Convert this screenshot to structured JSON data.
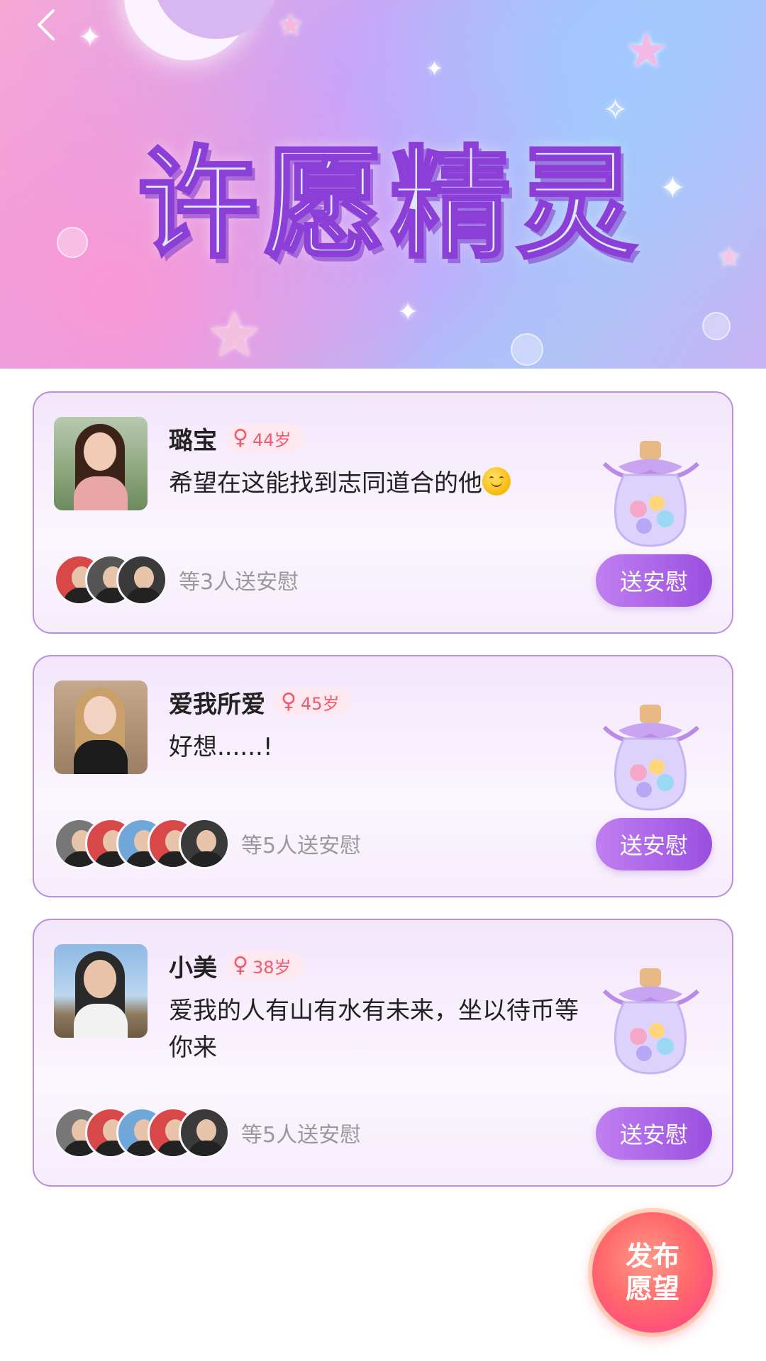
{
  "banner": {
    "title": "许愿精灵"
  },
  "wishes": [
    {
      "username": "璐宝",
      "age": "44岁",
      "gender_symbol": "♀",
      "text": "希望在这能找到志同道合的他",
      "supporters_text": "等3人送安慰",
      "comfort_label": "送安慰"
    },
    {
      "username": "爱我所爱",
      "age": "45岁",
      "gender_symbol": "♀",
      "text": "好想......!",
      "supporters_text": "等5人送安慰",
      "comfort_label": "送安慰"
    },
    {
      "username": "小美",
      "age": "38岁",
      "gender_symbol": "♀",
      "text": "爱我的人有山有水有未来，坐以待币等你来",
      "supporters_text": "等5人送安慰",
      "comfort_label": "送安慰"
    }
  ],
  "publish": {
    "label": "发布愿望"
  },
  "colors": {
    "accent": "#9a4fe0",
    "badge_text": "#ef5a6f",
    "publish": "#ff5a70"
  }
}
